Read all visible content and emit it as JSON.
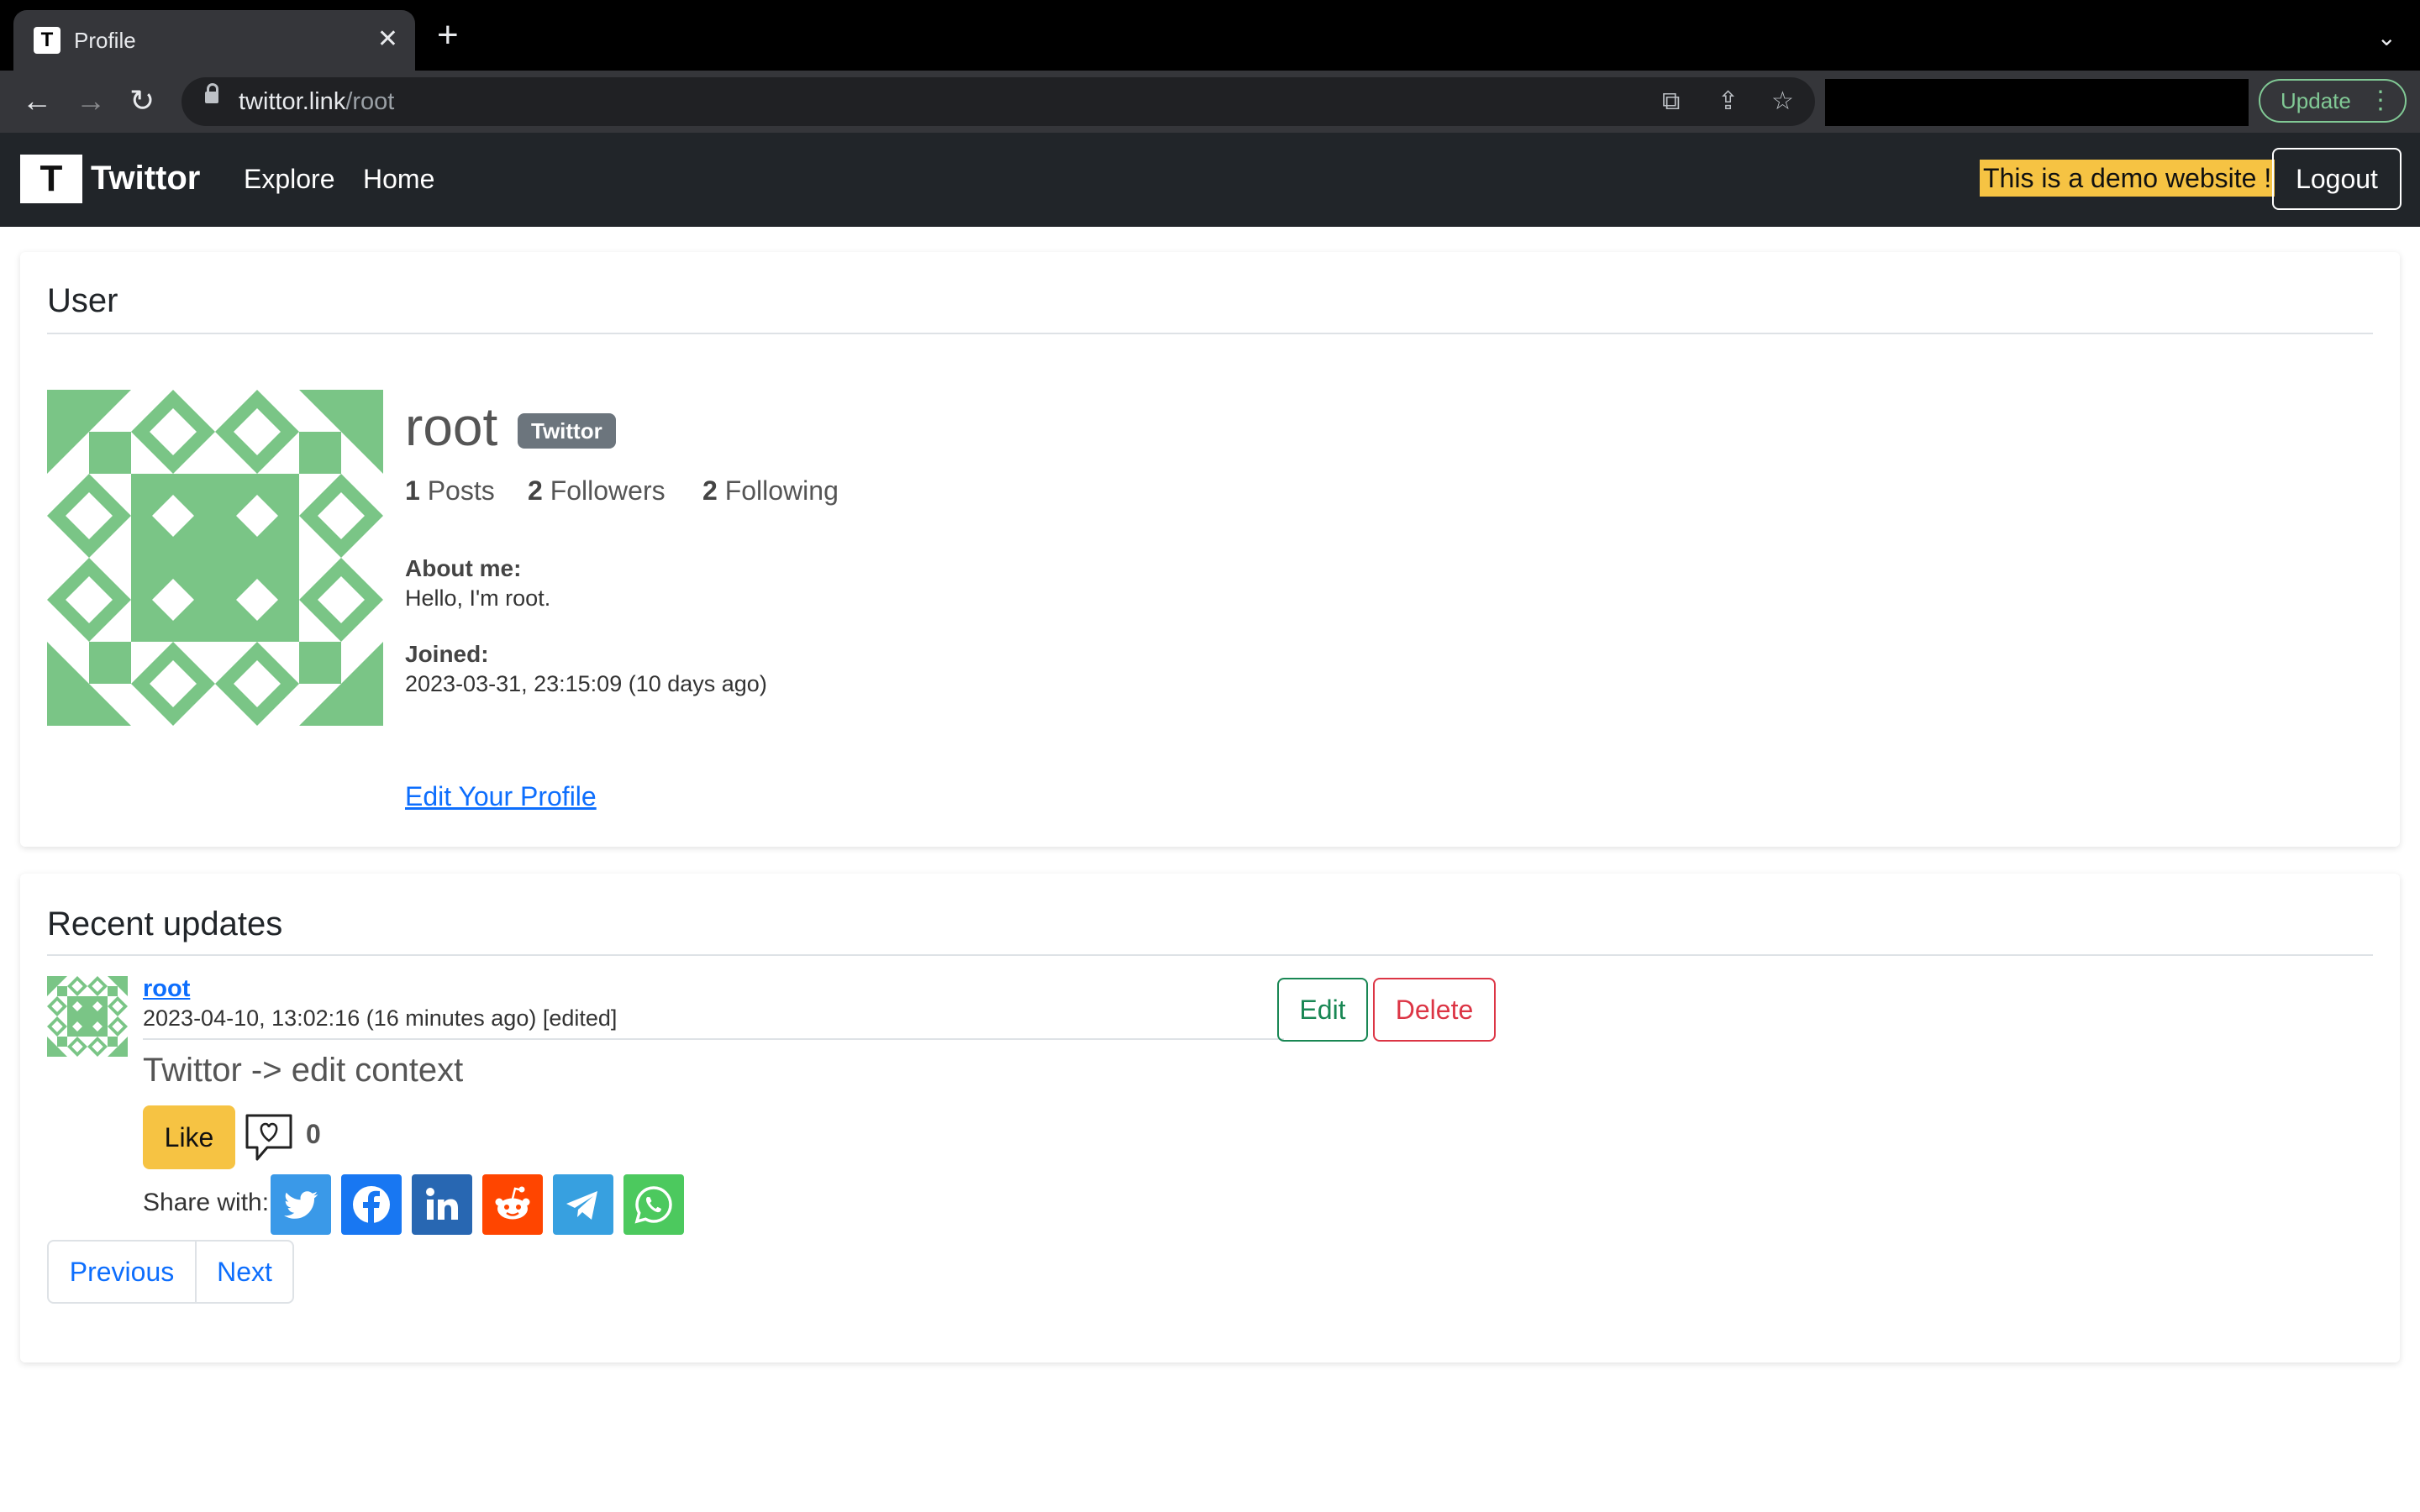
{
  "browser": {
    "tab_title": "Profile",
    "tab_favicon_letter": "T",
    "url_host": "twittor.link",
    "url_path": "/root",
    "update_label": "Update"
  },
  "navbar": {
    "brand_logo_letter": "T",
    "brand": "Twittor",
    "links": [
      "Explore",
      "Home"
    ],
    "demo_banner": "This is a demo website !",
    "logout": "Logout"
  },
  "user": {
    "section_title": "User",
    "username": "root",
    "badge": "Twittor",
    "posts_count": "1",
    "posts_label": "Posts",
    "followers_count": "2",
    "followers_label": "Followers",
    "following_count": "2",
    "following_label": "Following",
    "about_label": "About me:",
    "about_value": "Hello, I'm root.",
    "joined_label": "Joined:",
    "joined_value": "2023-03-31, 23:15:09 (10 days ago)",
    "edit_profile": "Edit Your Profile"
  },
  "updates": {
    "section_title": "Recent updates",
    "posts": [
      {
        "author": "root",
        "time": "2023-04-10, 13:02:16 (16 minutes ago) [edited]",
        "content": "Twittor -> edit context",
        "edit_label": "Edit",
        "delete_label": "Delete",
        "like_label": "Like",
        "like_count": "0"
      }
    ],
    "share_label": "Share with:",
    "share_services": [
      "twitter",
      "facebook",
      "linkedin",
      "reddit",
      "telegram",
      "whatsapp"
    ],
    "pager": {
      "previous": "Previous",
      "next": "Next"
    }
  },
  "colors": {
    "identicon": "#7ac586",
    "navbar_bg": "#212529",
    "demo_banner": "#f6c343",
    "link": "#0d6efd",
    "twitter": "#3a99e8",
    "facebook": "#1877f2",
    "linkedin": "#2867b2",
    "reddit": "#ff4500",
    "telegram": "#37a0e0",
    "whatsapp": "#4cc95e"
  }
}
